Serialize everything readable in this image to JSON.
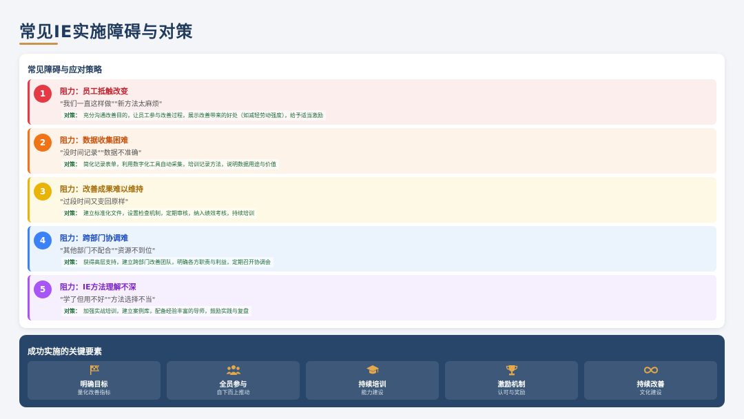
{
  "page": {
    "title": "常见IE实施障碍与对策"
  },
  "panel": {
    "title": "常见障碍与应对策略"
  },
  "obstacles": [
    {
      "num": "1",
      "heading": "阻力：员工抵触改变",
      "quote": "\"我们一直这样做\"\"新方法太麻烦\"",
      "strategy_label": "对策：",
      "strategy": "充分沟通改善目的，让员工参与改善过程，展示改善带来的好处（如减轻劳动强度），给予适当激励",
      "accent": "#e53945",
      "bg": "#fdeeee",
      "text": "#c0202c"
    },
    {
      "num": "2",
      "heading": "阻力：数据收集困难",
      "quote": "\"没时间记录\"\"数据不准确\"",
      "strategy_label": "对策：",
      "strategy": "简化记录表单，利用数字化工具自动采集，培训记录方法，说明数据用途与价值",
      "accent": "#f07316",
      "bg": "#fdf3e8",
      "text": "#c8510a"
    },
    {
      "num": "3",
      "heading": "阻力：改善成果难以维持",
      "quote": "\"过段时间又变回原样\"",
      "strategy_label": "对策：",
      "strategy": "建立标准化文件，设置检查机制，定期审核，纳入绩效考核，持续培训",
      "accent": "#eab308",
      "bg": "#fef9e4",
      "text": "#a46a06"
    },
    {
      "num": "4",
      "heading": "阻力：跨部门协调难",
      "quote": "\"其他部门不配合\"\"资源不到位\"",
      "strategy_label": "对策：",
      "strategy": "获得高层支持，建立跨部门改善团队，明确各方职责与利益，定期召开协调会",
      "accent": "#3b82f6",
      "bg": "#ebf3fd",
      "text": "#1e4fc0"
    },
    {
      "num": "5",
      "heading": "阻力：IE方法理解不深",
      "quote": "\"学了但用不好\"\"方法选择不当\"",
      "strategy_label": "对策：",
      "strategy": "加强实战培训，建立案例库，配备经验丰富的导师，鼓励实践与复盘",
      "accent": "#a855f7",
      "bg": "#f6effd",
      "text": "#7e22ce"
    }
  ],
  "success": {
    "title": "成功实施的关键要素",
    "factors": [
      {
        "icon": "flag-checkered-icon",
        "name": "明确目标",
        "sub": "量化改善指标"
      },
      {
        "icon": "users-icon",
        "name": "全员参与",
        "sub": "自下而上推动"
      },
      {
        "icon": "graduation-cap-icon",
        "name": "持续培训",
        "sub": "能力建设"
      },
      {
        "icon": "trophy-icon",
        "name": "激励机制",
        "sub": "认可与奖励"
      },
      {
        "icon": "infinity-icon",
        "name": "持续改善",
        "sub": "文化建设"
      }
    ],
    "icon_color": "#e2a84b"
  }
}
